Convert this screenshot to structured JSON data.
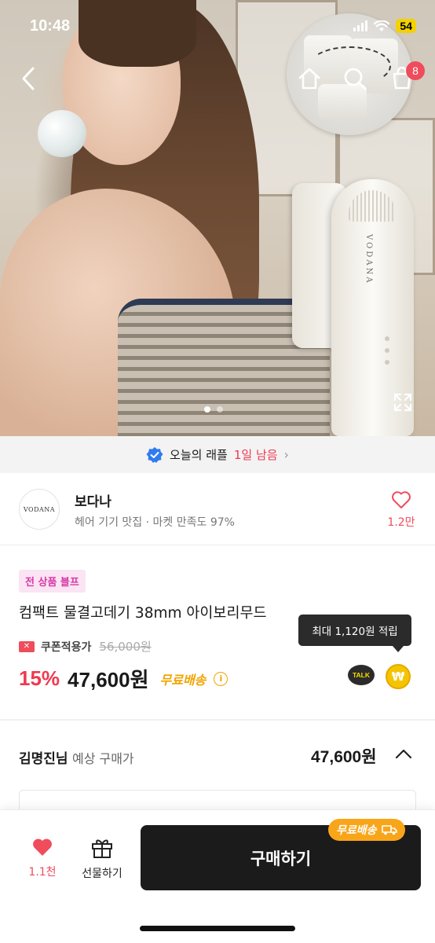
{
  "status": {
    "time": "10:48",
    "battery": "54"
  },
  "nav": {
    "cart_count": "8",
    "icons": [
      "back-chevron-icon",
      "home-icon",
      "search-icon",
      "cart-icon",
      "fullscreen-icon"
    ]
  },
  "hero": {
    "brand_text": "VODANA",
    "pager": {
      "current": 1,
      "total": 2
    }
  },
  "raffle": {
    "text": "오늘의 래플",
    "highlight": "1일 남음"
  },
  "shop": {
    "logo_text": "VODANA",
    "name": "보다나",
    "description": "헤어 기기 맛집 · 마켓 만족도 97%",
    "like_count": "1.2만"
  },
  "product": {
    "tag": "전 상품 블프",
    "title": "컴팩트 물결고데기 38mm 아이보리무드",
    "coupon_label": "쿠폰적용가",
    "original_price": "56,000원",
    "discount": "15%",
    "price": "47,600원",
    "free_shipping": "무료배송",
    "tooltip": "최대 1,120원 적립",
    "talk_label": "TALK",
    "won_symbol": "₩"
  },
  "expected": {
    "name": "김명진님",
    "label": "예상 구매가",
    "amount": "47,600원"
  },
  "bottom_bar": {
    "like_count": "1.1천",
    "gift_label": "선물하기",
    "buy_label": "구매하기",
    "buy_badge": "무료배송"
  },
  "colors": {
    "accent_red": "#ef3950",
    "shipping_orange": "#f2a400",
    "badge_orange": "#f9a51a",
    "buy_button": "#1b1b1b"
  }
}
